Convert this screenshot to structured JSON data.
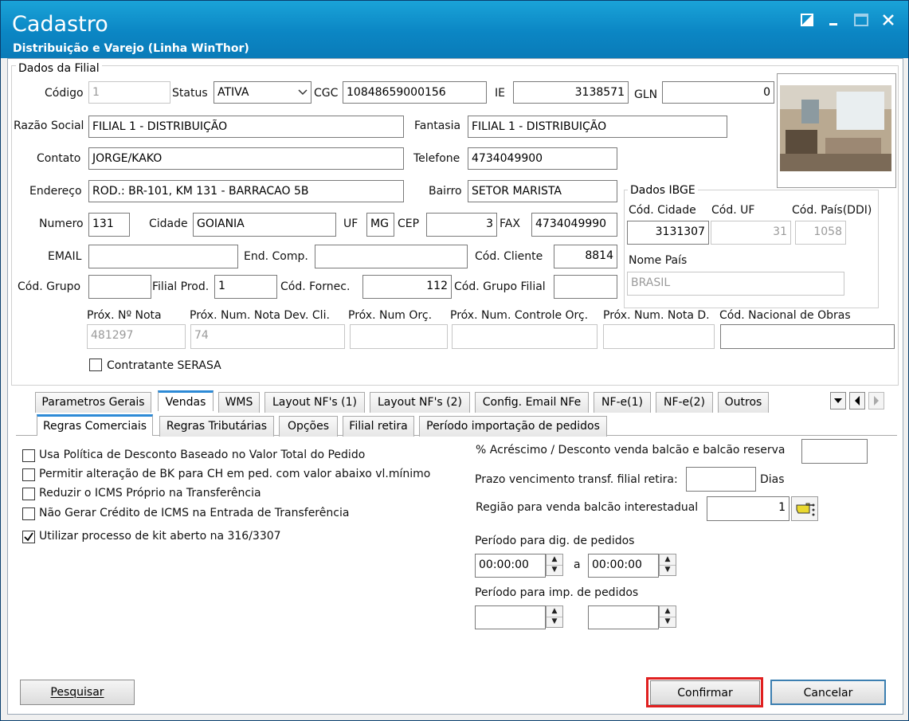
{
  "window": {
    "title": "Cadastro",
    "subtitle": "Distribuição e Varejo (Linha WinThor)",
    "icons": [
      "restore-icon",
      "minimize-icon",
      "maximize-icon",
      "close-icon"
    ]
  },
  "dados_filial": {
    "group_title": "Dados da Filial",
    "codigo_label": "Código",
    "codigo": "1",
    "status_label": "Status",
    "status": "ATIVA",
    "cgc_label": "CGC",
    "cgc": "10848659000156",
    "ie_label": "IE",
    "ie": "3138571",
    "gln_label": "GLN",
    "gln": "0",
    "razao_label": "Razão Social",
    "razao": "FILIAL 1 - DISTRIBUIÇÃO",
    "fantasia_label": "Fantasia",
    "fantasia": "FILIAL 1 - DISTRIBUIÇÃO",
    "contato_label": "Contato",
    "contato": "JORGE/KAKO",
    "telefone_label": "Telefone",
    "telefone": "4734049900",
    "endereco_label": "Endereço",
    "endereco": "ROD.: BR-101, KM 131 - BARRACAO 5B",
    "bairro_label": "Bairro",
    "bairro": "SETOR MARISTA",
    "numero_label": "Numero",
    "numero": "131",
    "cidade_label": "Cidade",
    "cidade": "GOIANIA",
    "uf_label": "UF",
    "uf": "MG",
    "cep_label": "CEP",
    "cep": "3",
    "fax_label": "FAX",
    "fax": "4734049990",
    "email_label": "EMAIL",
    "email": "",
    "endcomp_label": "End. Comp.",
    "endcomp": "",
    "codcliente_label": "Cód. Cliente",
    "codcliente": "8814",
    "codgrupo_label": "Cód. Grupo",
    "codgrupo": "",
    "filialprod_label": "Filial Prod.",
    "filialprod": "1",
    "codfornec_label": "Cód. Fornec.",
    "codfornec": "112",
    "codgrupofilial_label": "Cód. Grupo Filial",
    "codgrupofilial": "",
    "prox_nota_label": "Próx. Nº Nota",
    "prox_nota": "481297",
    "prox_dev_label": "Próx. Num. Nota Dev. Cli.",
    "prox_dev": "74",
    "prox_orc_label": "Próx. Num Orç.",
    "prox_orc": "",
    "prox_ctrl_label": "Próx. Num. Controle Orç.",
    "prox_ctrl": "",
    "prox_notad_label": "Próx. Num. Nota D.",
    "prox_notad": "",
    "cod_obras_label": "Cód. Nacional de Obras",
    "cod_obras": "",
    "serasa_label": "Contratante SERASA",
    "serasa_checked": false
  },
  "ibge": {
    "group_title": "Dados IBGE",
    "cod_cidade_label": "Cód. Cidade",
    "cod_cidade": "3131307",
    "cod_uf_label": "Cód. UF",
    "cod_uf": "31",
    "cod_pais_label": "Cód. País(DDI)",
    "cod_pais": "1058",
    "nome_pais_label": "Nome País",
    "nome_pais": "BRASIL"
  },
  "tabs_top": [
    "Parametros Gerais",
    "Vendas",
    "WMS",
    "Layout NF's (1)",
    "Layout NF's (2)",
    "Config. Email NFe",
    "NF-e(1)",
    "NF-e(2)",
    "Outros"
  ],
  "tabs_sub": [
    "Regras Comerciais",
    "Regras Tributárias",
    "Opções",
    "Filial retira",
    "Período importação de pedidos"
  ],
  "options": [
    {
      "label": "Usa Política de Desconto Baseado no Valor Total do Pedido",
      "checked": false
    },
    {
      "label": "Permitir alteração de BK para CH em ped. com valor abaixo vl.mínimo",
      "checked": false
    },
    {
      "label": "Reduzir o ICMS Próprio na Transferência",
      "checked": false
    },
    {
      "label": "Não Gerar Crédito de ICMS na Entrada de Transferência",
      "checked": false
    },
    {
      "label": "Utilizar processo de kit aberto na 316/3307",
      "checked": true
    }
  ],
  "right": {
    "acrescimo_label": "% Acréscimo / Desconto venda balcão e balcão reserva",
    "acrescimo": "",
    "prazo_label": "Prazo vencimento transf. filial retira:",
    "prazo": "",
    "prazo_unit": "Dias",
    "regiao_label": "Região para venda balcão interestadual",
    "regiao": "1",
    "periodo_dig_label": "Período para dig. de pedidos",
    "periodo_dig_de": "00:00:00",
    "periodo_sep": "a",
    "periodo_dig_ate": "00:00:00",
    "periodo_imp_label": "Período para imp. de pedidos",
    "periodo_imp_de": "",
    "periodo_imp_ate": ""
  },
  "buttons": {
    "pesquisar": "Pesquisar",
    "confirmar": "Confirmar",
    "cancelar": "Cancelar"
  },
  "colors": {
    "titlebar": "#0b86c4",
    "highlight": "#e02020",
    "default_button_border": "#3c7fb1"
  }
}
